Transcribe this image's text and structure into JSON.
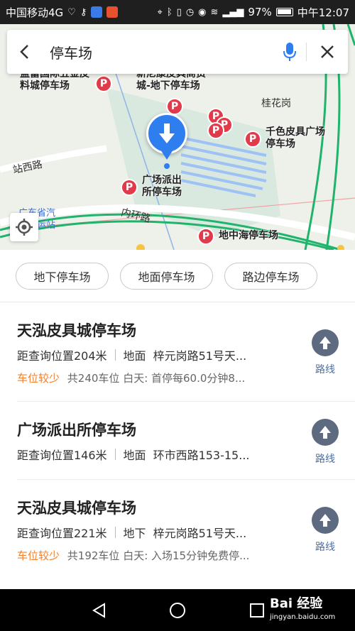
{
  "status_bar": {
    "carrier": "中国移动4G",
    "battery": "97%",
    "time": "中午12:07"
  },
  "search": {
    "query": "停车场"
  },
  "map": {
    "roads": [
      "站西路",
      "内环路"
    ],
    "areas": [
      "桂花岗",
      "广东省汽车客运站"
    ],
    "pois": [
      {
        "name": "盈富国际五金皮料城停车场"
      },
      {
        "name": "新尼康皮具商贸城-地下停车场"
      },
      {
        "name": "千色皮具广场停车场"
      },
      {
        "name": "广场派出所停车场"
      },
      {
        "name": "地中海停车场"
      }
    ],
    "pin_letter": "P"
  },
  "filters": [
    "地下停车场",
    "地面停车场",
    "路边停车场"
  ],
  "results": [
    {
      "title": "天泓皮具城停车场",
      "distance": "距查询位置204米",
      "type": "地面",
      "address": "梓元岗路51号天...",
      "availability": "车位较少",
      "details": "共240车位 白天: 首停每60.0分钟8...",
      "route_label": "路线"
    },
    {
      "title": "广场派出所停车场",
      "distance": "距查询位置146米",
      "type": "地面",
      "address": "环市西路153-15...",
      "availability": "",
      "details": "",
      "route_label": "路线"
    },
    {
      "title": "天泓皮具城停车场",
      "distance": "距查询位置221米",
      "type": "地下",
      "address": "梓元岗路51号天...",
      "availability": "车位较少",
      "details": "共192车位 白天: 入场15分钟免费停...",
      "route_label": "路线"
    }
  ],
  "watermark": {
    "brand": "Bai 经验",
    "url": "jingyan.baidu.com"
  },
  "colors": {
    "pin": "#e13a4a",
    "location": "#2f7ef0",
    "availability": "#f0812f",
    "route_button": "#5d6a80",
    "route_label": "#4a6fa5"
  }
}
